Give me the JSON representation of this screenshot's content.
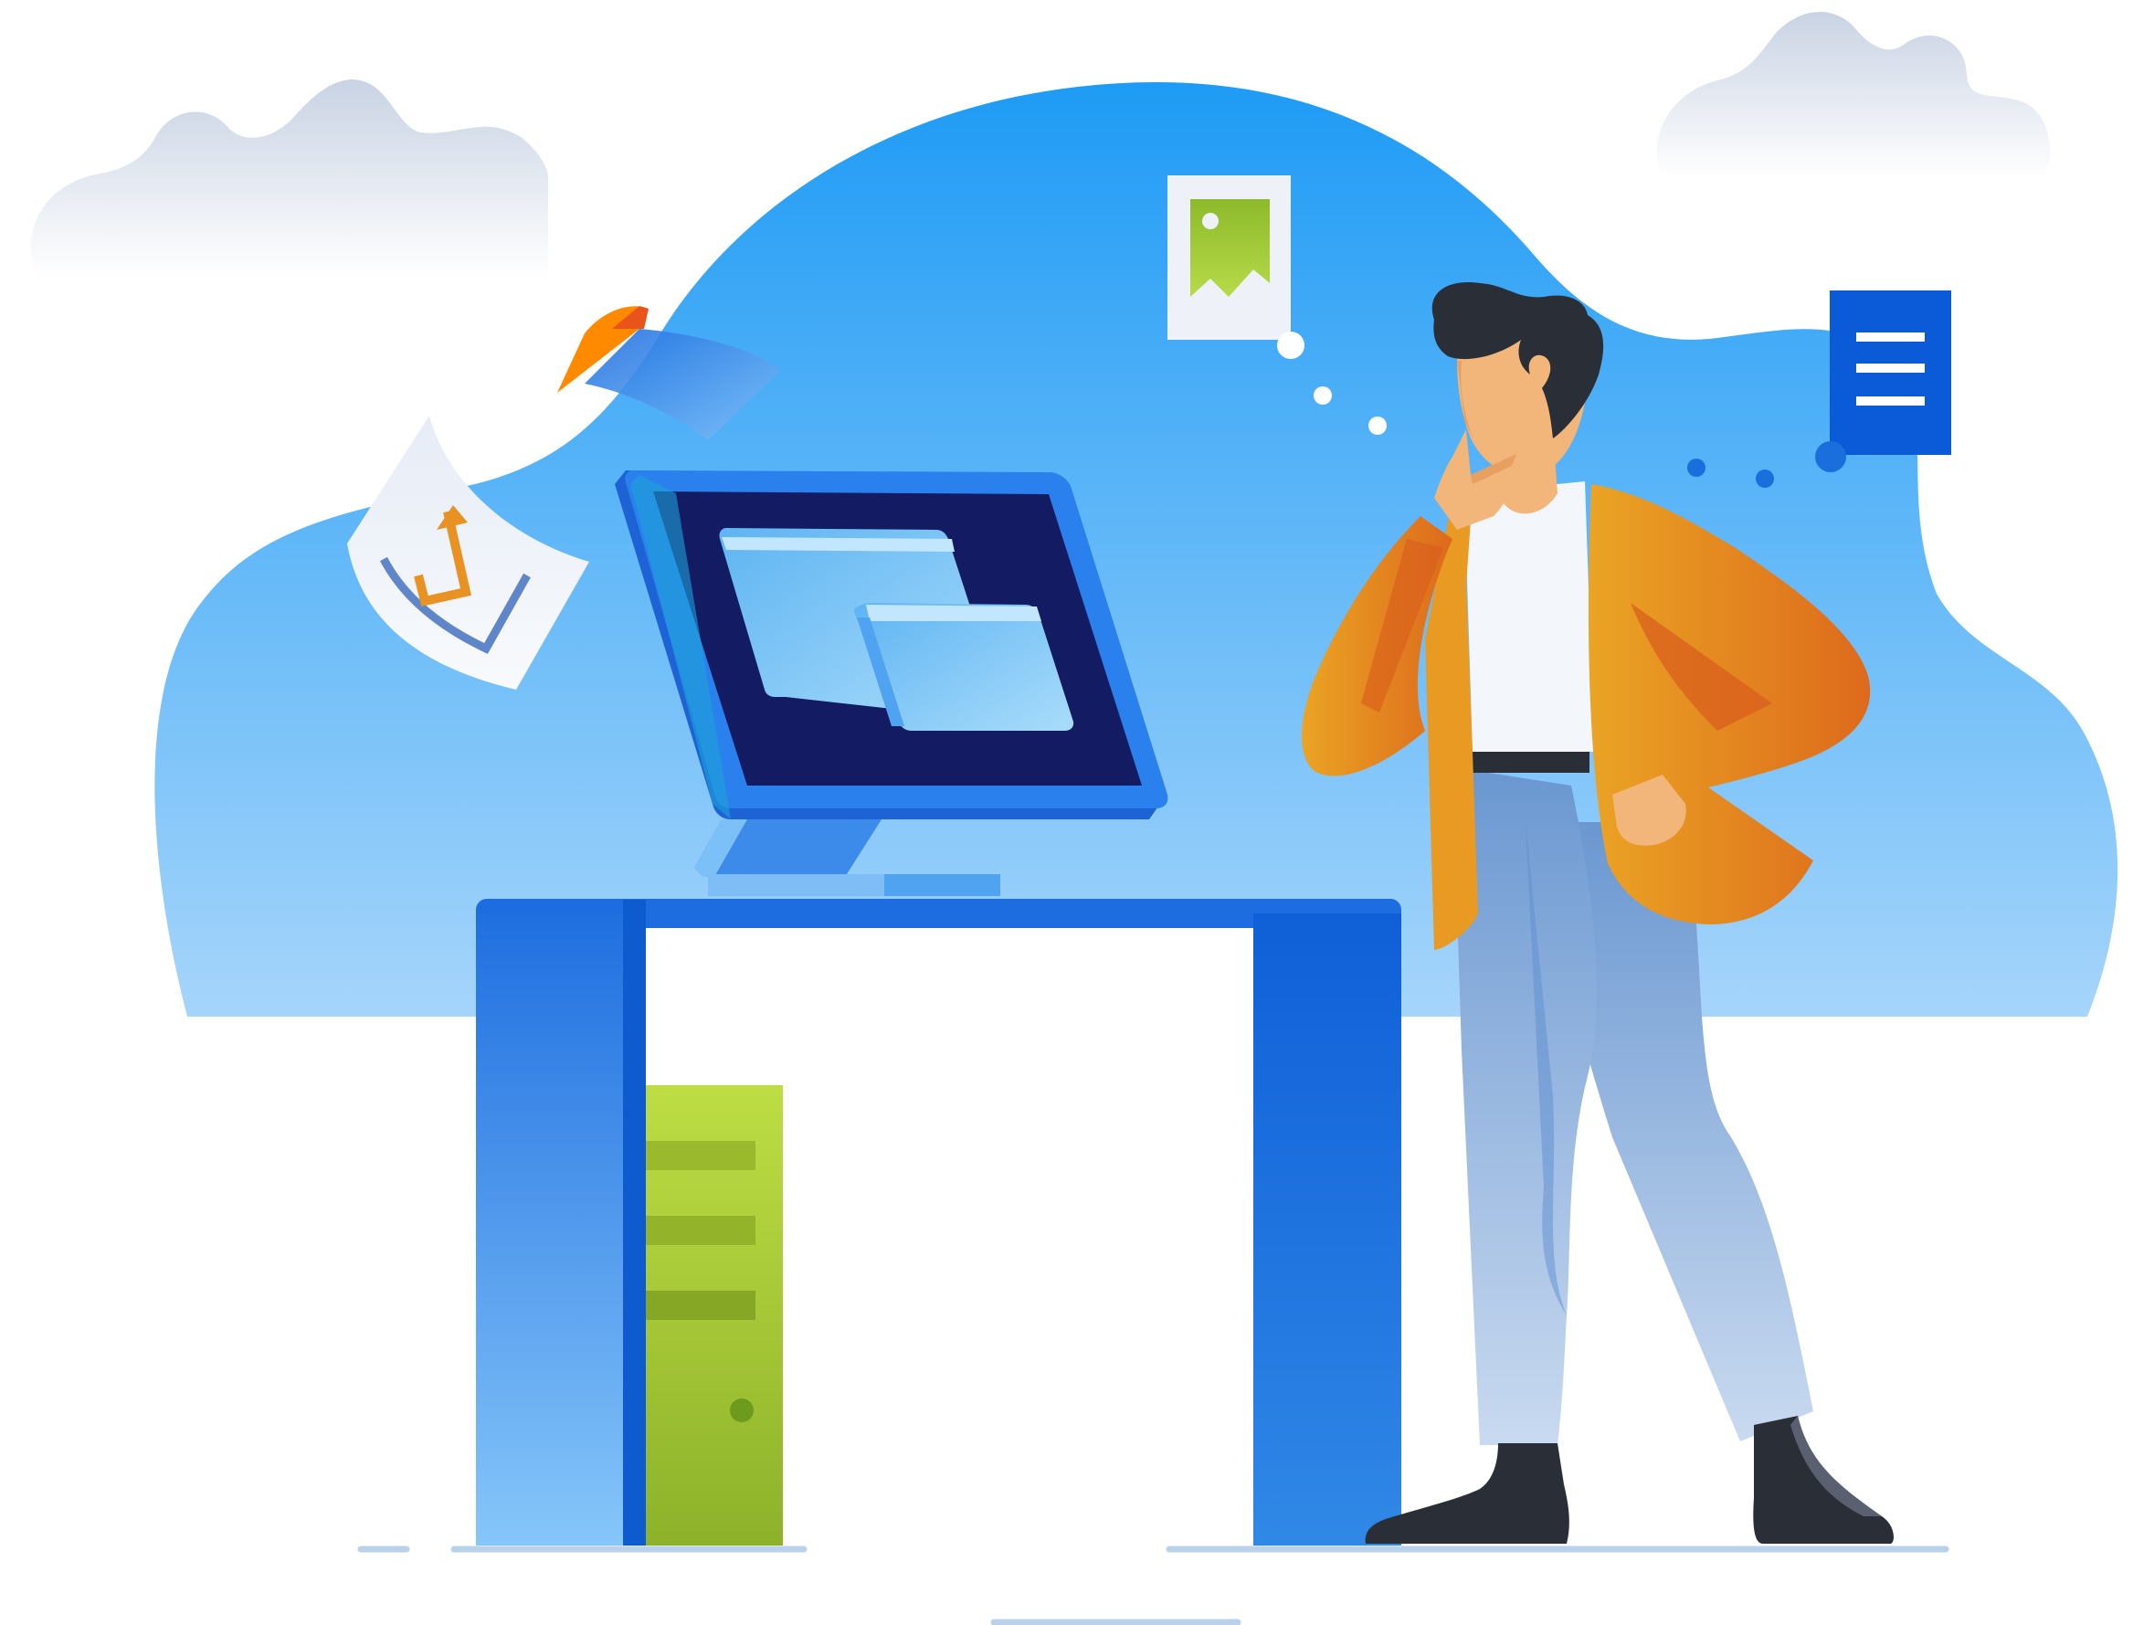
{
  "illustration": {
    "subject": "person-thinking-at-computer-desk",
    "colors": {
      "sky_top": "#1E9BF5",
      "sky_bottom": "#A6D5FB",
      "cloud": "#DDE4EE",
      "desk": "#1F6FE0",
      "desk_light": "#7CC0F8",
      "monitor_frame": "#1F73E6",
      "monitor_screen": "#131B62",
      "folder": "#8ED0F7",
      "server_tower": "#9CC12A",
      "jacket": "#E8821E",
      "jacket_dark": "#D95B1C",
      "skin": "#F2B57A",
      "hair": "#2A2E36",
      "pants": "#7FA5D8",
      "shirt": "#F3F6FA",
      "document_icon": "#0B5BD8",
      "image_card": "#EEF2F8",
      "image_icon": "#8DBA2B"
    },
    "icons": [
      "image-thought-icon",
      "document-thought-icon",
      "chart-paper-icon",
      "folder-icon"
    ]
  }
}
